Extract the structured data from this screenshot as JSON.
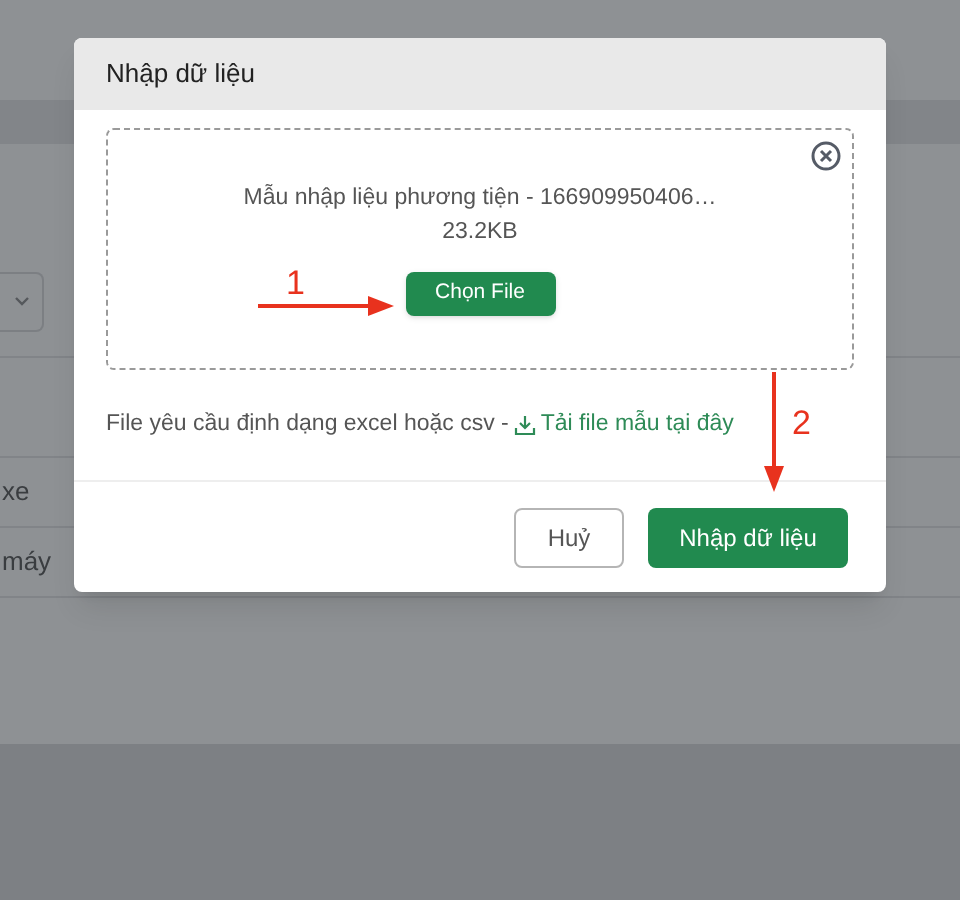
{
  "background": {
    "row_labels": [
      "xe",
      "máy"
    ]
  },
  "dialog": {
    "title": "Nhập dữ liệu",
    "file": {
      "name": "Mẫu nhập liệu phương tiện - 166909950406…",
      "size": "23.2KB"
    },
    "choose_button": "Chọn File",
    "hint": "File yêu cầu định dạng excel hoặc csv -",
    "template_link": "Tải file mẫu tại đây",
    "buttons": [
      {
        "label": "Huỷ",
        "kind": "secondary"
      },
      {
        "label": "Nhập dữ liệu",
        "kind": "primary"
      }
    ]
  },
  "annotations": [
    {
      "label": "1",
      "kind": "horizontal"
    },
    {
      "label": "2",
      "kind": "vertical"
    }
  ]
}
